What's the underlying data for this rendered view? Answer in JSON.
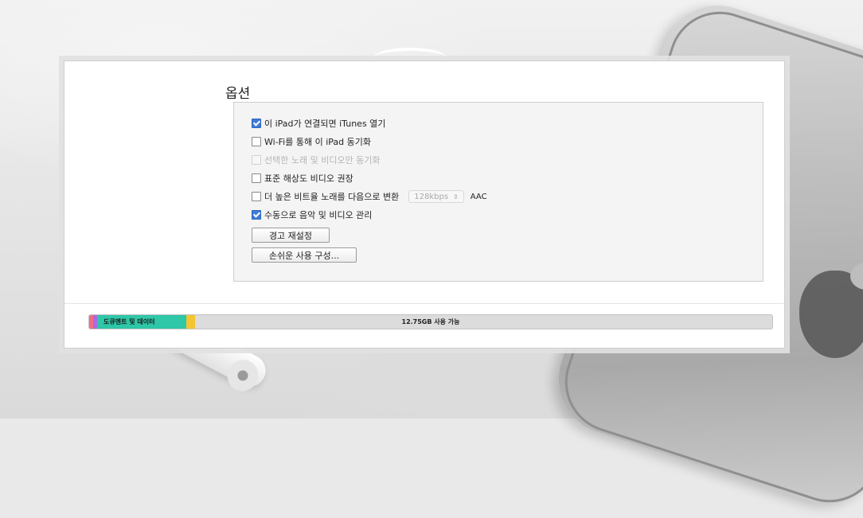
{
  "options": {
    "title": "옵션",
    "items": [
      {
        "label": "이 iPad가 연결되면 iTunes 열기",
        "checked": true,
        "disabled": false
      },
      {
        "label": "Wi-Fi를 통해 이 iPad 동기화",
        "checked": false,
        "disabled": false
      },
      {
        "label": "선택한 노래 및 비디오만 동기화",
        "checked": false,
        "disabled": true
      },
      {
        "label": "표준 해상도 비디오 권장",
        "checked": false,
        "disabled": false
      },
      {
        "label": "더 높은 비트율 노래를 다음으로 변환",
        "checked": false,
        "disabled": false
      },
      {
        "label": "수동으로 음악 및 비디오 관리",
        "checked": true,
        "disabled": false
      }
    ],
    "bitrate_select": {
      "value": "128kbps",
      "icon": "updown-arrow-icon"
    },
    "codec": "AAC",
    "reset_warnings_button": "경고 재설정",
    "accessibility_button": "손쉬운 사용 구성..."
  },
  "storage": {
    "segments": [
      {
        "label": "",
        "color": "#f06c86",
        "fraction": 0.006
      },
      {
        "label": "",
        "color": "#a86ae0",
        "fraction": 0.006
      },
      {
        "label": "도큐멘트 및 데이터",
        "color": "#2ec7a7",
        "fraction": 0.131
      },
      {
        "label": "",
        "color": "#f2c531",
        "fraction": 0.013
      }
    ],
    "available_label": "12.75GB 사용 가능"
  }
}
